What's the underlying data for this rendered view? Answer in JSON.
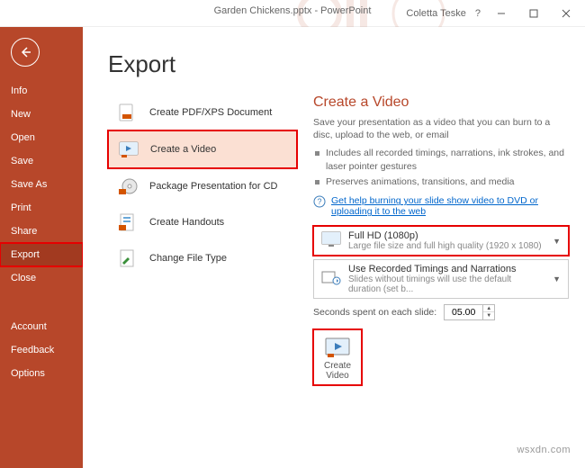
{
  "window": {
    "title": "Garden Chickens.pptx - PowerPoint",
    "user": "Coletta Teske",
    "help": "?"
  },
  "sidebar": {
    "items": [
      "Info",
      "New",
      "Open",
      "Save",
      "Save As",
      "Print",
      "Share",
      "Export",
      "Close"
    ],
    "active": "Export",
    "footer": [
      "Account",
      "Feedback",
      "Options"
    ]
  },
  "page": {
    "title": "Export"
  },
  "export_options": [
    {
      "label": "Create PDF/XPS Document"
    },
    {
      "label": "Create a Video",
      "selected": true
    },
    {
      "label": "Package Presentation for CD"
    },
    {
      "label": "Create Handouts"
    },
    {
      "label": "Change File Type"
    }
  ],
  "video": {
    "heading": "Create a Video",
    "description": "Save your presentation as a video that you can burn to a disc, upload to the web, or email",
    "bullets": [
      "Includes all recorded timings, narrations, ink strokes, and laser pointer gestures",
      "Preserves animations, transitions, and media"
    ],
    "help_link": "Get help burning your slide show video to DVD or uploading it to the web",
    "quality": {
      "label": "Full HD (1080p)",
      "sub": "Large file size and full high quality (1920 x 1080)"
    },
    "timings": {
      "label": "Use Recorded Timings and Narrations",
      "sub": "Slides without timings will use the default duration (set b..."
    },
    "seconds_label": "Seconds spent on each slide:",
    "seconds_value": "05.00",
    "create_button": "Create\nVideo"
  },
  "watermark": "wsxdn.com"
}
